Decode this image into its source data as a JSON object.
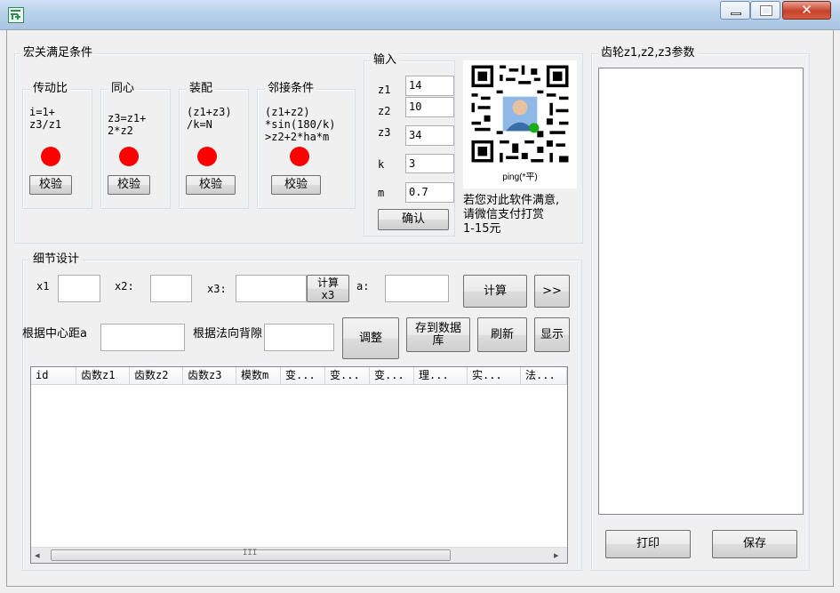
{
  "window": {
    "minimize_glyph": "▁",
    "maximize_glyph": "▭",
    "close_glyph": "✕"
  },
  "macro": {
    "legend": "宏关满足条件",
    "cards": [
      {
        "title": "传动比",
        "formula": "i=1+\nz3/z1",
        "verify_label": "校验"
      },
      {
        "title": "同心",
        "formula": "z3=z1+\n2*z2",
        "verify_label": "校验"
      },
      {
        "title": "装配",
        "formula": "(z1+z3)\n/k=N",
        "verify_label": "校验"
      },
      {
        "title": "邻接条件",
        "formula": "(z1+z2)\n*sin(180/k)\n>z2+2*ha*m",
        "verify_label": "校验"
      }
    ],
    "status_color": "#ff0000"
  },
  "input": {
    "legend": "输入",
    "fields": [
      {
        "label": "z1",
        "value": "14"
      },
      {
        "label": "z2",
        "value": "10"
      },
      {
        "label": "z3",
        "value": "34"
      },
      {
        "label": "k",
        "value": "3"
      },
      {
        "label": "m",
        "value": "0.7"
      }
    ],
    "confirm_label": "确认"
  },
  "donate": {
    "qr_caption": "ping(*平)",
    "message": "若您对此软件满意,\n请微信支付打赏\n1-15元"
  },
  "detail": {
    "legend": "细节设计",
    "x1_label": "x1",
    "x1_value": "",
    "x2_label": "x2:",
    "x2_value": "",
    "x3_label": "x3:",
    "x3_value": "",
    "calc_x3_label": "计算\nx3",
    "a_label": "a:",
    "a_value": "",
    "calc_label": "计算",
    "more_label": ">>",
    "center_dist_label": "根据中心距a",
    "center_dist_value": "",
    "normal_back_label": "根据法向背隙",
    "normal_back_value": "",
    "adjust_label": "调整",
    "save_db_label": "存到数据\n库",
    "refresh_label": "刷新",
    "show_label": "显示"
  },
  "grid": {
    "columns": [
      "id",
      "齿数z1",
      "齿数z2",
      "齿数z3",
      "模数m",
      "变...",
      "变...",
      "变...",
      "理...",
      "实...",
      "法..."
    ],
    "scroll_grip": "III",
    "scroll_left": "◂",
    "scroll_right": "▸"
  },
  "params": {
    "legend": "齿轮z1,z2,z3参数",
    "print_label": "打印",
    "save_label": "保存"
  }
}
